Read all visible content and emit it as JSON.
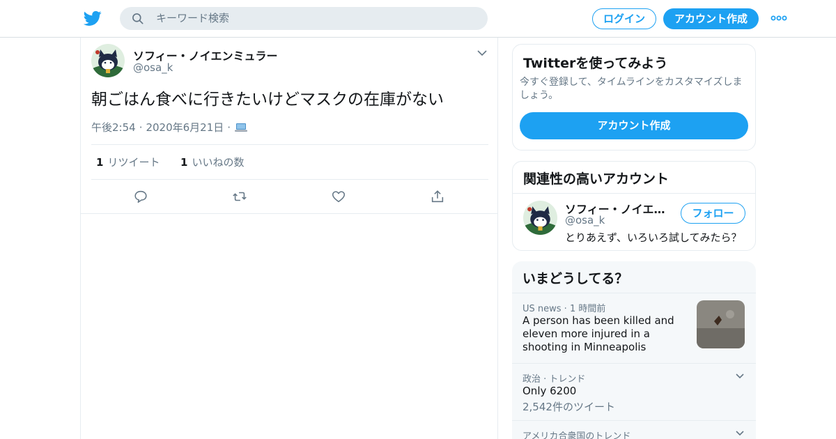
{
  "header": {
    "search_placeholder": "キーワード検索",
    "login_label": "ログイン",
    "signup_label": "アカウント作成",
    "brand_color": "#1da1f2"
  },
  "tweet": {
    "author_name": "ソフィー・ノイエンミュラー",
    "author_handle": "@osa_k",
    "text": "朝ごはん食べに行きたいけどマスクの在庫がない",
    "time": "午後2:54",
    "date": "2020年6月21日",
    "source_icon": "laptop-icon",
    "retweet_count": "1",
    "retweet_label": "リツイート",
    "like_count": "1",
    "like_label": "いいねの数"
  },
  "signup_card": {
    "title": "Twitterを使ってみよう",
    "description": "今すぐ登録して、タイムラインをカスタマイズしましょう。",
    "cta_label": "アカウント作成"
  },
  "related": {
    "title": "関連性の高いアカウント",
    "name": "ソフィー・ノイエンミュラー",
    "handle": "@osa_k",
    "follow_label": "フォロー",
    "bio": "とりあえず、いろいろ試してみたら？"
  },
  "trends": {
    "title": "いまどうしてる？",
    "items": [
      {
        "category": "US news",
        "time": "1 時間前",
        "headline": "A person has been killed and eleven more injured in a shooting in Minneapolis"
      },
      {
        "category": "政治 · トレンド",
        "headline": "Only 6200",
        "count": "2,542件のツイート"
      },
      {
        "category": "アメリカ合衆国のトレンド"
      }
    ]
  }
}
